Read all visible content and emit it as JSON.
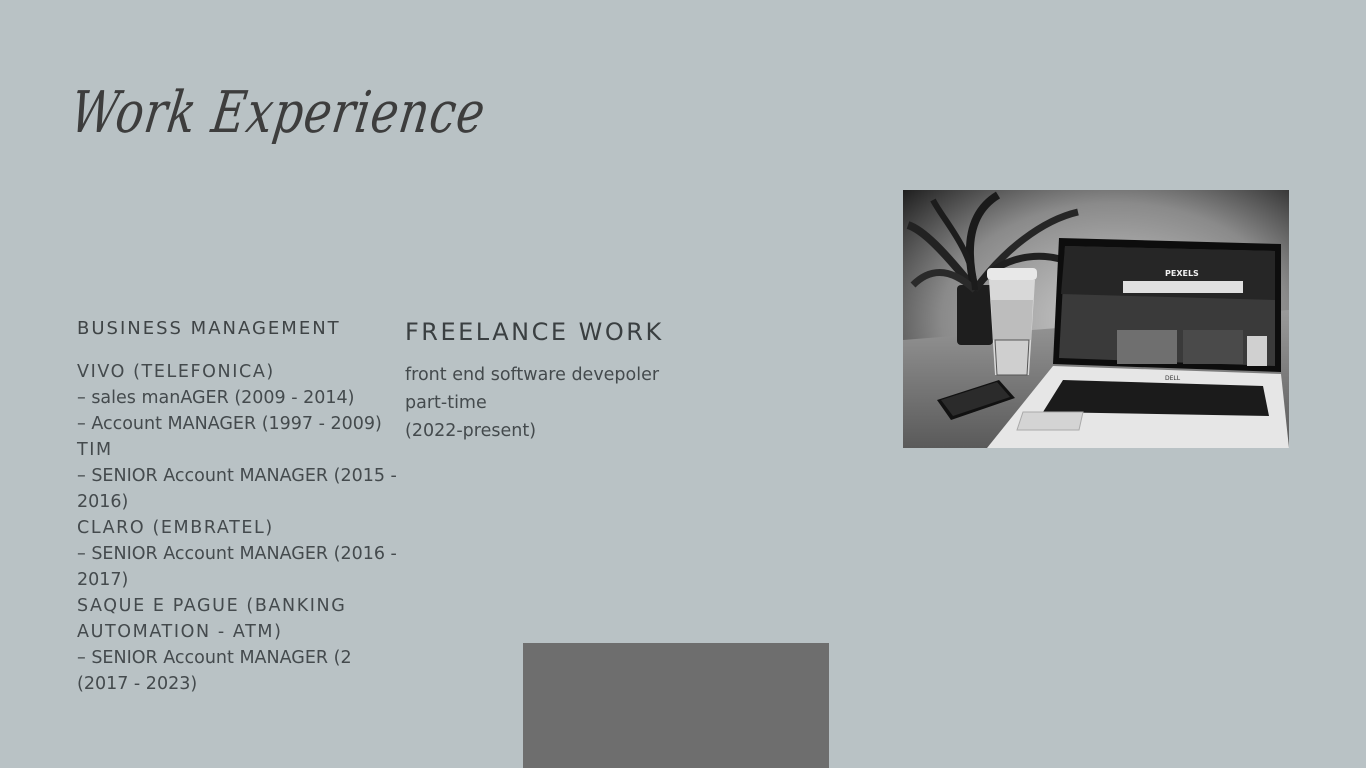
{
  "title": "Work Experience",
  "business": {
    "heading": "BUSINESS MANAGEMENT",
    "lines": [
      {
        "kind": "company",
        "text": "VIVO (TELEFONICA)"
      },
      {
        "kind": "role",
        "text": "– sales manAGER (2009 - 2014)"
      },
      {
        "kind": "role",
        "text": "– Account MANAGER (1997 - 2009)"
      },
      {
        "kind": "company",
        "text": "TIM"
      },
      {
        "kind": "role",
        "text": "– SENIOR Account MANAGER (2015 - 2016)"
      },
      {
        "kind": "company",
        "text": "CLARO (EMBRATEL)"
      },
      {
        "kind": "role",
        "text": "– SENIOR Account MANAGER (2016 - 2017)"
      },
      {
        "kind": "company",
        "text": "SAQUE E PAGUE (BANKING AUTOMATION - ATM)"
      },
      {
        "kind": "role",
        "text": "– SENIOR Account MANAGER (2 (2017 - 2023)"
      }
    ]
  },
  "freelance": {
    "heading": "FREELANCE WORK",
    "lines": [
      "front end software devepoler",
      "part-time",
      "(2022-present)"
    ]
  },
  "photo": {
    "screen_brand": "PEXELS",
    "laptop_brand": "DELL"
  },
  "colors": {
    "background": "#b9c2c5",
    "text": "#444a4d",
    "block": "#6e6e6e"
  }
}
